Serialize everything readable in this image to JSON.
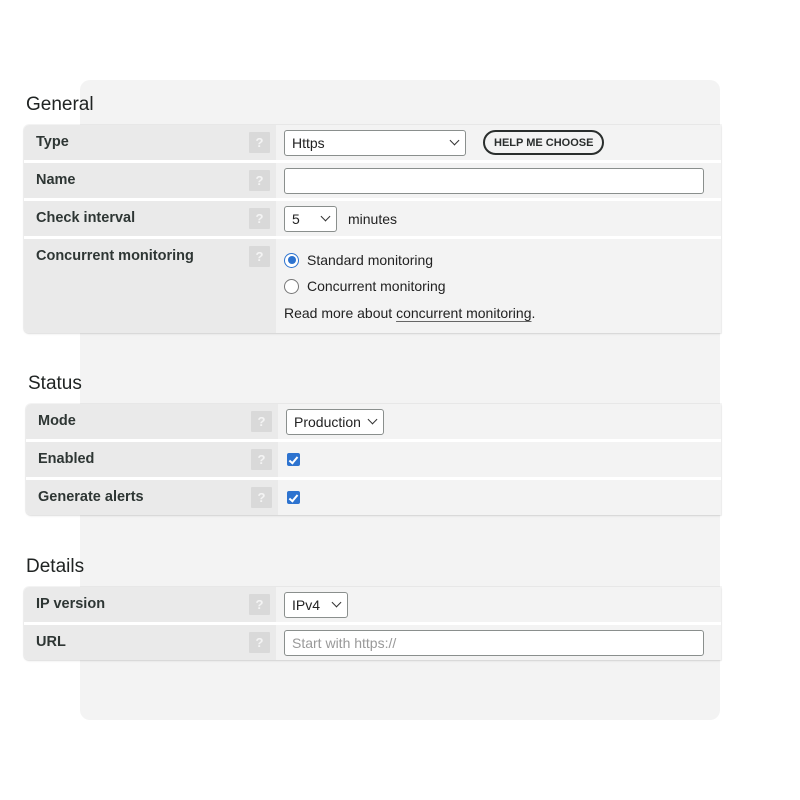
{
  "help_glyph": "?",
  "general": {
    "title": "General",
    "type": {
      "label": "Type",
      "value": "Https",
      "help_button_label": "HELP ME CHOOSE"
    },
    "name": {
      "label": "Name",
      "value": ""
    },
    "check_interval": {
      "label": "Check interval",
      "value": "5",
      "unit": "minutes"
    },
    "concurrent": {
      "label": "Concurrent monitoring",
      "options": [
        {
          "label": "Standard monitoring",
          "selected": true
        },
        {
          "label": "Concurrent monitoring",
          "selected": false
        }
      ],
      "read_more_prefix": "Read more about ",
      "read_more_link": "concurrent monitoring",
      "read_more_suffix": "."
    }
  },
  "status": {
    "title": "Status",
    "mode": {
      "label": "Mode",
      "value": "Production"
    },
    "enabled": {
      "label": "Enabled",
      "checked": true
    },
    "generate_alerts": {
      "label": "Generate alerts",
      "checked": true
    }
  },
  "details": {
    "title": "Details",
    "ip_version": {
      "label": "IP version",
      "value": "IPv4"
    },
    "url": {
      "label": "URL",
      "value": "",
      "placeholder": "Start with https://"
    }
  },
  "colors": {
    "accent": "#2d73cf",
    "label_bg": "#eaeaea",
    "value_bg": "#f3f3f3",
    "help_bg": "#d9d9d9"
  }
}
